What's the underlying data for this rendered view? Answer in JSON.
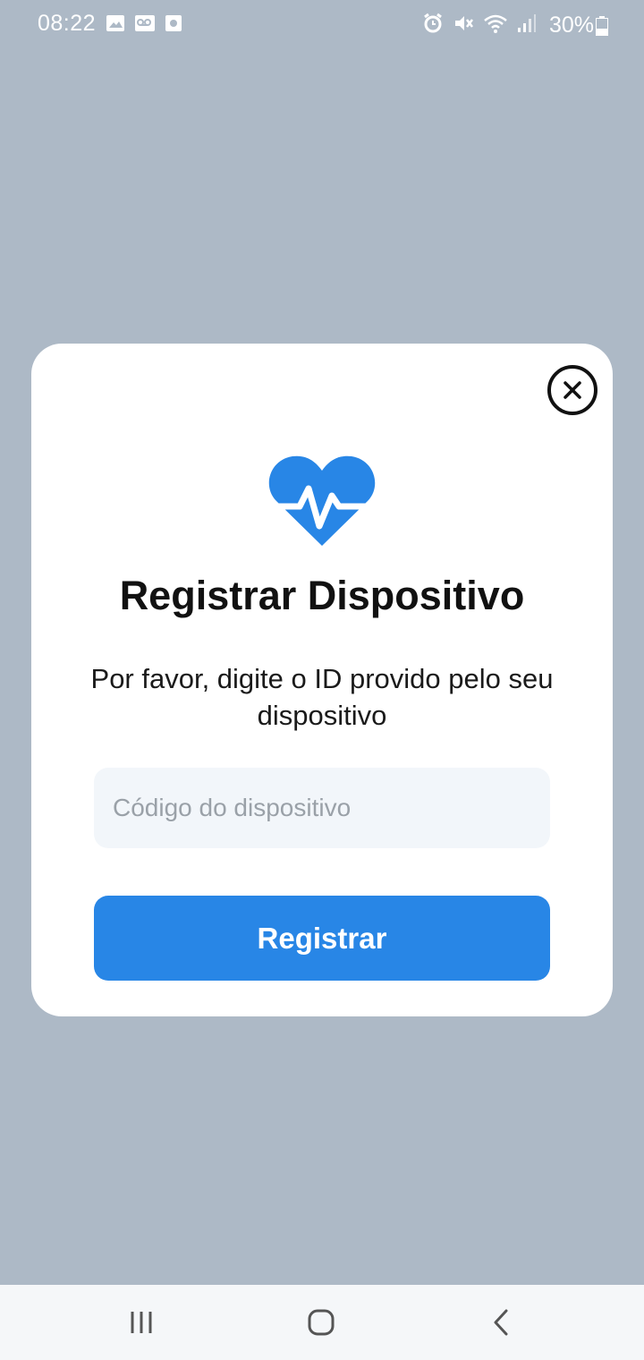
{
  "status_bar": {
    "time": "08:22",
    "battery_percent": "30%",
    "left_icons": [
      "image-icon",
      "voicemail-icon",
      "screen-record-icon"
    ],
    "right_icons": [
      "alarm-icon",
      "mute-icon",
      "wifi-icon",
      "signal-icon",
      "battery-icon"
    ]
  },
  "dialog": {
    "title": "Registrar Dispositivo",
    "subtitle": "Por favor, digite o ID provido pelo seu dispositivo",
    "input": {
      "placeholder": "Código do dispositivo",
      "value": ""
    },
    "submit_label": "Registrar",
    "icon": "heart-pulse-icon",
    "accent_color": "#2886e6"
  },
  "nav_bar": {
    "buttons": [
      "recent-apps-icon",
      "home-icon",
      "back-icon"
    ]
  }
}
